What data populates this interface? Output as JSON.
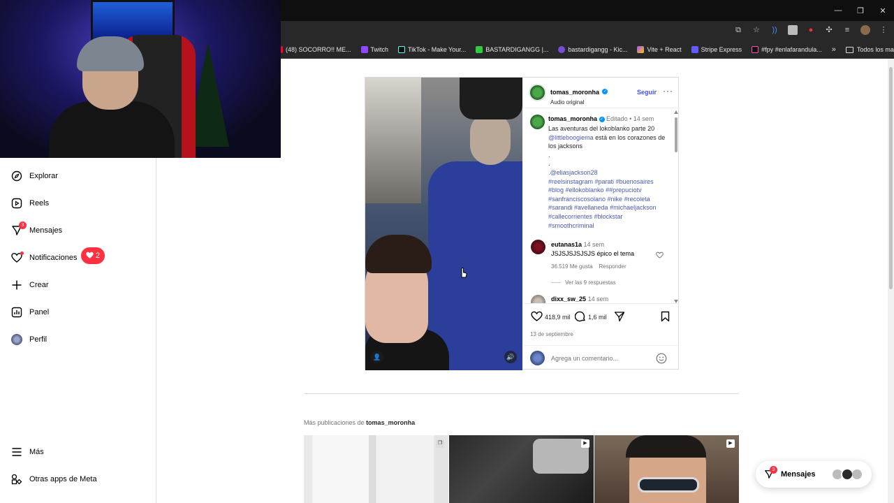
{
  "browser": {
    "bookmarks": [
      {
        "label": "(48) SOCORRO!! ME...",
        "color": "#ff0033"
      },
      {
        "label": "Twitch",
        "color": "#9146ff"
      },
      {
        "label": "TikTok - Make Your...",
        "color": "#111111"
      },
      {
        "label": "BASTARDIGANGG |...",
        "color": "#2ecc40"
      },
      {
        "label": "bastardigangg - Kic...",
        "color": "#7a4dd6"
      },
      {
        "label": "Vite + React",
        "color": "#f5c518"
      },
      {
        "label": "Stripe Express",
        "color": "#635bff"
      },
      {
        "label": "#fpy #enlafarandula...",
        "color": "#111111"
      }
    ],
    "more_bookmarks": "»",
    "all_bookmarks": "Todos los marcadores"
  },
  "sidebar": {
    "items": [
      {
        "label": "Explorar",
        "icon": "compass-icon"
      },
      {
        "label": "Reels",
        "icon": "reels-icon"
      },
      {
        "label": "Mensajes",
        "icon": "messenger-icon",
        "badge": "3"
      },
      {
        "label": "Notificaciones",
        "icon": "heart-icon"
      },
      {
        "label": "Crear",
        "icon": "plus-icon"
      },
      {
        "label": "Panel",
        "icon": "chart-icon"
      },
      {
        "label": "Perfil",
        "icon": "avatar"
      }
    ],
    "notification_count": "2",
    "more": "Más",
    "meta_apps": "Otras apps de Meta"
  },
  "post": {
    "header": {
      "username": "tomas_moronha",
      "subtitle": "Audio original",
      "follow": "Seguir"
    },
    "caption": {
      "username": "tomas_moronha",
      "edited": "Editado",
      "time": "14 sem",
      "line1": "Las aventuras del lokoblanko parte 20",
      "mention": "@littleboogiema",
      "after_mention": " está en los corazones de los jacksons",
      "dot1": ".",
      "dot2": ".",
      "mention2": ".@eliasjackson28",
      "hashtags": "#reelsinstagram #parati #buenosaires #blog #ellokoblanko ##prepuciotv #sanfranciscosolano #nike #recoleta #sarandi #avellaneda #michaeljackson #callecorrientes #blockstar #smoothcriminal"
    },
    "comments": [
      {
        "username": "eutanas1a",
        "time": "14 sem",
        "text": "JSJSJSJSJSJS épico el tema",
        "likes": "36.519 Me gusta",
        "reply": "Responder",
        "view_replies": "Ver las 9 respuestas"
      },
      {
        "username": "dixx_sw_25",
        "time": "14 sem"
      }
    ],
    "likes": "418,9 mil",
    "comment_count": "1,6 mil",
    "date": "13 de septiembre",
    "add_comment_placeholder": "Agrega un comentario..."
  },
  "more_posts": {
    "prefix": "Más publicaciones de ",
    "username": "tomas_moronha"
  },
  "messages_pill": {
    "label": "Mensajes",
    "badge": "3"
  }
}
